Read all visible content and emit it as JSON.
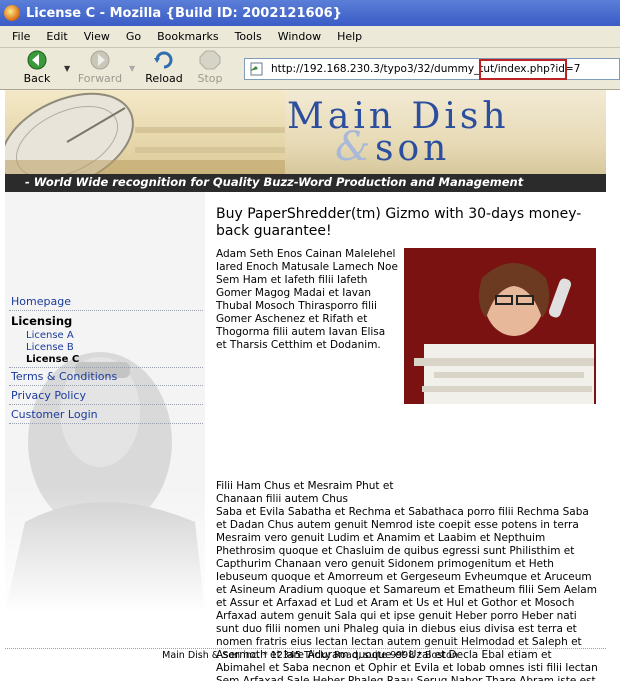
{
  "window": {
    "title": "License C - Mozilla {Build ID: 2002121606}"
  },
  "menubar": {
    "items": [
      "File",
      "Edit",
      "View",
      "Go",
      "Bookmarks",
      "Tools",
      "Window",
      "Help"
    ]
  },
  "toolbar": {
    "back": "Back",
    "forward": "Forward",
    "reload": "Reload",
    "stop": "Stop"
  },
  "address": {
    "url": "http://192.168.230.3/typo3/32/dummy_tut/index.php?id=7"
  },
  "banner": {
    "logo_line1": "Main Dish",
    "logo_amp": "&",
    "logo_line2": "son",
    "tagline": "- World Wide recognition for Quality Buzz-Word Production and Management"
  },
  "sidebar": {
    "homepage": "Homepage",
    "licensing": "Licensing",
    "licenses": [
      "License A",
      "License B",
      "License C"
    ],
    "terms": "Terms & Conditions",
    "privacy": "Privacy Policy",
    "login": "Customer Login"
  },
  "content": {
    "headline": "Buy PaperShredder(tm) Gizmo with 30-days money-back guarantee!",
    "para1": "Adam Seth Enos Cainan Malelehel Iared Enoch Matusale Lamech Noe Sem Ham et Iafeth filii Iafeth Gomer Magog Madai et Iavan Thubal Mosoch Thirasporro filii Gomer Aschenez et Rifath et Thogorma filii autem Iavan Elisa et Tharsis Cetthim et Dodanim.",
    "para2_a": "Filii Ham Chus et Mesraim Phut et Chanaan filii autem Chus",
    "para2_b": "Saba et Evila Sabatha et Rechma et Sabathaca porro filii Rechma Saba et Dadan Chus autem genuit Nemrod iste coepit esse potens in terra Mesraim vero genuit Ludim et Anamim et Laabim et Nepthuim Phethrosim quoque et Chasluim de quibus egressi sunt Philisthim et Capthurim Chanaan vero genuit Sidonem primogenitum et Heth Iebuseum quoque et Amorreum et Gergeseum Evheumque et Aruceum et Asineum Aradium quoque et Samareum et Ematheum filii Sem Aelam et Assur et Arfaxad et Lud et Aram et Us et Hul et Gothor et Mosoch Arfaxad autem genuit Sala qui et ipse genuit Heber porro Heber nati sunt duo filii nomen uni Phaleg quia in diebus eius divisa est terra et nomen fratris eius Iectan Iectan autem genuit Helmodad et Saleph et Asermoth et Iare Aduram quoque et Uzal et Decla Ebal etiam et Abimahel et Saba necnon et Ophir et Evila et Iobab omnes isti filii Iectan Sem Arfaxad Sale Heber Phaleg Raau Serug Nahor Thare Abram iste est Abraham filii autem Abraham Isaac et Ismahel et hae generationes eorum primogenitus Ismahelis Nabaioth et Cedar et Adbeel et Mabsam"
  },
  "footer": {
    "text": "Main Dish & Son inc. * 12345 Tricky Road, suite 9998 * Boston"
  }
}
